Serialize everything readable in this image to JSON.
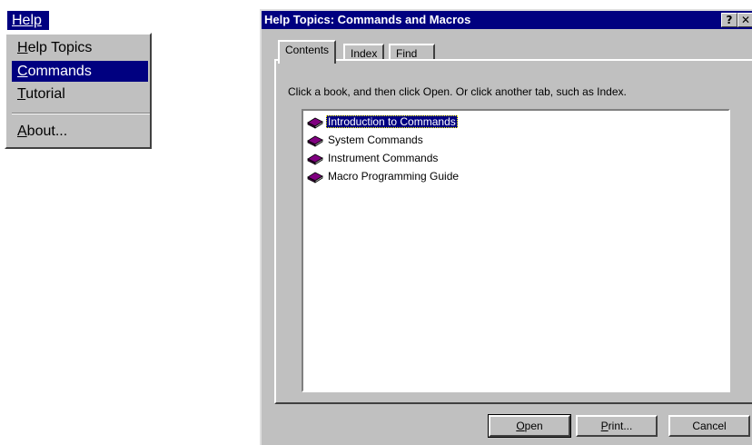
{
  "help_menu": {
    "header": "Help",
    "items": [
      {
        "label": "Help Topics",
        "first": "H",
        "rest": "elp Topics",
        "selected": false
      },
      {
        "label": "Commands",
        "first": "C",
        "rest": "ommands",
        "selected": true
      },
      {
        "label": "Tutorial",
        "first": "T",
        "rest": "utorial",
        "selected": false
      },
      {
        "label": "About...",
        "first": "A",
        "rest": "bout...",
        "selected": false
      }
    ]
  },
  "dialog": {
    "title": "Help Topics: Commands and Macros",
    "help_glyph": "?",
    "close_glyph": "✕",
    "tabs": [
      "Contents",
      "Index",
      "Find"
    ],
    "active_tab": "Contents",
    "instructions": "Click a book, and then click Open. Or click another tab, such as Index.",
    "topics": [
      {
        "label": "Introduction to Commands",
        "selected": true
      },
      {
        "label": "System Commands",
        "selected": false
      },
      {
        "label": "Instrument Commands",
        "selected": false
      },
      {
        "label": "Macro Programming Guide",
        "selected": false
      }
    ],
    "buttons": {
      "open": {
        "label": "Open",
        "first": "O",
        "rest": "pen"
      },
      "print": {
        "label": "Print...",
        "first": "P",
        "rest": "rint..."
      },
      "cancel": {
        "label": "Cancel"
      }
    },
    "colors": {
      "titlebar": "#000080",
      "face": "#c0c0c0",
      "book": "#800080"
    }
  }
}
